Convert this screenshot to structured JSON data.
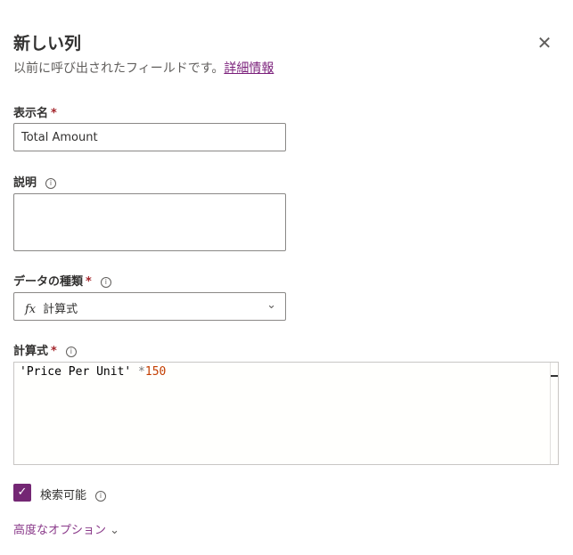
{
  "panel": {
    "title": "新しい列",
    "subtitle": "以前に呼び出されたフィールドです。",
    "learn_more": "詳細情報",
    "close_icon": "close-icon"
  },
  "display_name": {
    "label": "表示名",
    "required": "*",
    "value": "Total Amount"
  },
  "description": {
    "label": "説明",
    "value": ""
  },
  "data_type": {
    "label": "データの種類",
    "required": "*",
    "icon": "fx",
    "value": "計算式"
  },
  "formula": {
    "label": "計算式",
    "required": "*",
    "string": "'Price Per Unit'",
    "operator": " *",
    "number": "150"
  },
  "searchable": {
    "label": "検索可能",
    "checked": true
  },
  "advanced": {
    "label": "高度なオプション"
  },
  "colors": {
    "accent": "#742774",
    "required": "#a4262c",
    "number": "#c33d00"
  }
}
